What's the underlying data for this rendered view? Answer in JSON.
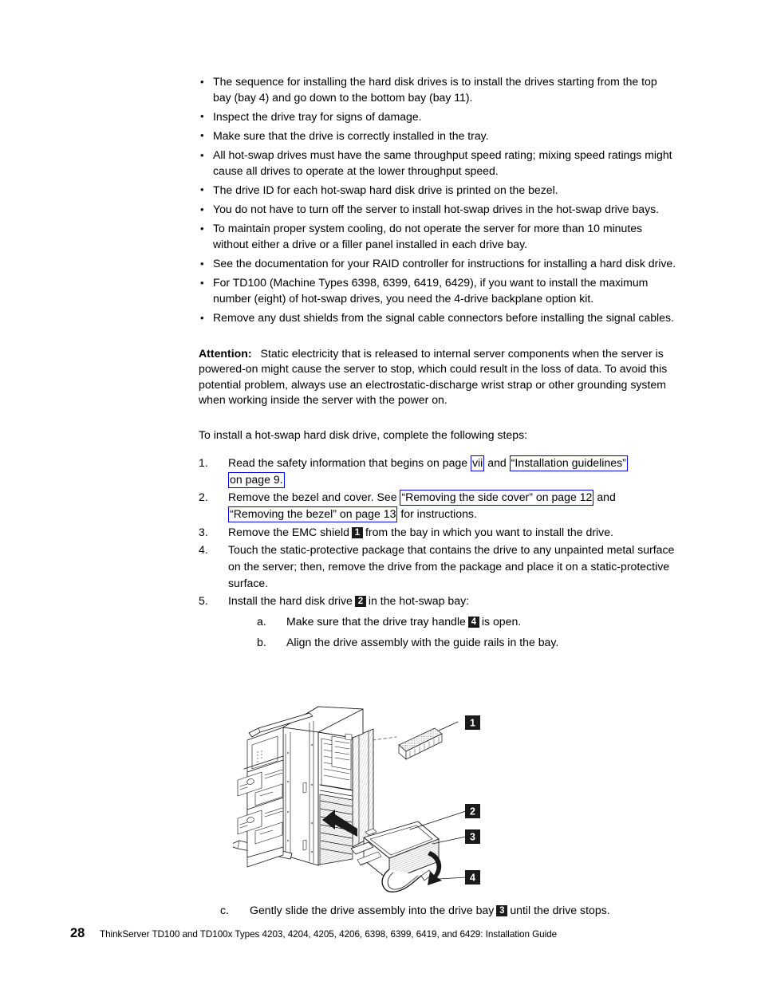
{
  "document": {
    "title": "ThinkServer TD100 and TD100x Installation Guide",
    "page_number": "28",
    "footer_text": "ThinkServer TD100 and TD100x Types 4203, 4204, 4205, 4206, 6398, 6399, 6419, and 6429:  Installation Guide"
  },
  "bullets": [
    "The sequence for installing the hard disk drives is to install the drives starting from the top bay (bay 4) and go down to the bottom bay (bay 11).",
    "Inspect the drive tray for signs of damage.",
    "Make sure that the drive is correctly installed in the tray.",
    "All hot-swap drives must have the same throughput speed rating; mixing speed ratings might cause all drives to operate at the lower throughput speed.",
    "The drive ID for each hot-swap hard disk drive is printed on the bezel.",
    "You do not have to turn off the server to install hot-swap drives in the hot-swap drive bays.",
    "To maintain proper system cooling, do not operate the server for more than 10 minutes without either a drive or a filler panel installed in each drive bay.",
    "See the documentation for your RAID controller for instructions for installing a hard disk drive.",
    "For TD100 (Machine Types 6398, 6399, 6419, 6429), if you want to install the maximum number (eight) of hot-swap drives, you need the 4-drive backplane option kit.",
    "Remove any dust shields from the signal cable connectors before installing the signal cables."
  ],
  "attention": {
    "label": "Attention:",
    "body": "Static electricity that is released to internal server components when the server is powered-on might cause the server to stop, which could result in the loss of data. To avoid this potential problem, always use an electrostatic-discharge wrist strap or other grounding system when working inside the server with the power on."
  },
  "intro": "To install a hot-swap hard disk drive, complete the following steps:",
  "steps": {
    "step1": {
      "num": "1.",
      "text_before": "Read the safety information that begins on page ",
      "link_page_vii": "vii",
      "text_mid": " and ",
      "link_install_guidelines_a": "“Installation guidelines”",
      "link_install_guidelines_b": "on page 9."
    },
    "step2": {
      "num": "2.",
      "text_before": "Remove the bezel and cover. See ",
      "link_side_cover": "“Removing the side cover” on page 12",
      "text_mid": " and ",
      "link_bezel": "“Removing the bezel” on page 13",
      "text_after": " for instructions."
    },
    "step3": {
      "num": "3.",
      "text_before": "Remove the EMC shield",
      "callout": "1",
      "text_after": "from the bay in which you want to install the drive."
    },
    "step4": {
      "num": "4.",
      "text": "Touch the static-protective package that contains the drive to any unpainted metal surface on the server; then, remove the drive from the package and place it on a static-protective surface."
    },
    "step5": {
      "num": "5.",
      "text_before": "Install the hard disk drive",
      "callout": "2",
      "text_after": "in the hot-swap bay:",
      "substeps": {
        "a": {
          "num": "a.",
          "text_before": "Make sure that the drive tray handle",
          "callout": "4",
          "text_after": "is open."
        },
        "b": {
          "num": "b.",
          "text": "Align the drive assembly with the guide rails in the bay."
        },
        "c": {
          "num": "c.",
          "text_before": "Gently slide the drive assembly into the drive bay",
          "callout": "3",
          "text_after": "until the drive stops."
        }
      }
    }
  },
  "figure": {
    "name": "hot-swap-hard-disk-drive-installation-diagram",
    "description": "Line drawing of the server tower with side cover removed, an EMC shield being removed from a drive bay, and a hot-swap hard disk drive tray being inserted into the hot-swap bay with its tray handle open.",
    "callouts": [
      {
        "id": "1",
        "label": "EMC shield"
      },
      {
        "id": "2",
        "label": "Hard disk drive"
      },
      {
        "id": "3",
        "label": "Drive bay"
      },
      {
        "id": "4",
        "label": "Drive tray handle"
      }
    ]
  },
  "colors": {
    "link_border": "#0000dd",
    "callout_background": "#1a1a1a",
    "callout_text": "#ffffff",
    "text": "#000000",
    "page_background": "#ffffff"
  }
}
